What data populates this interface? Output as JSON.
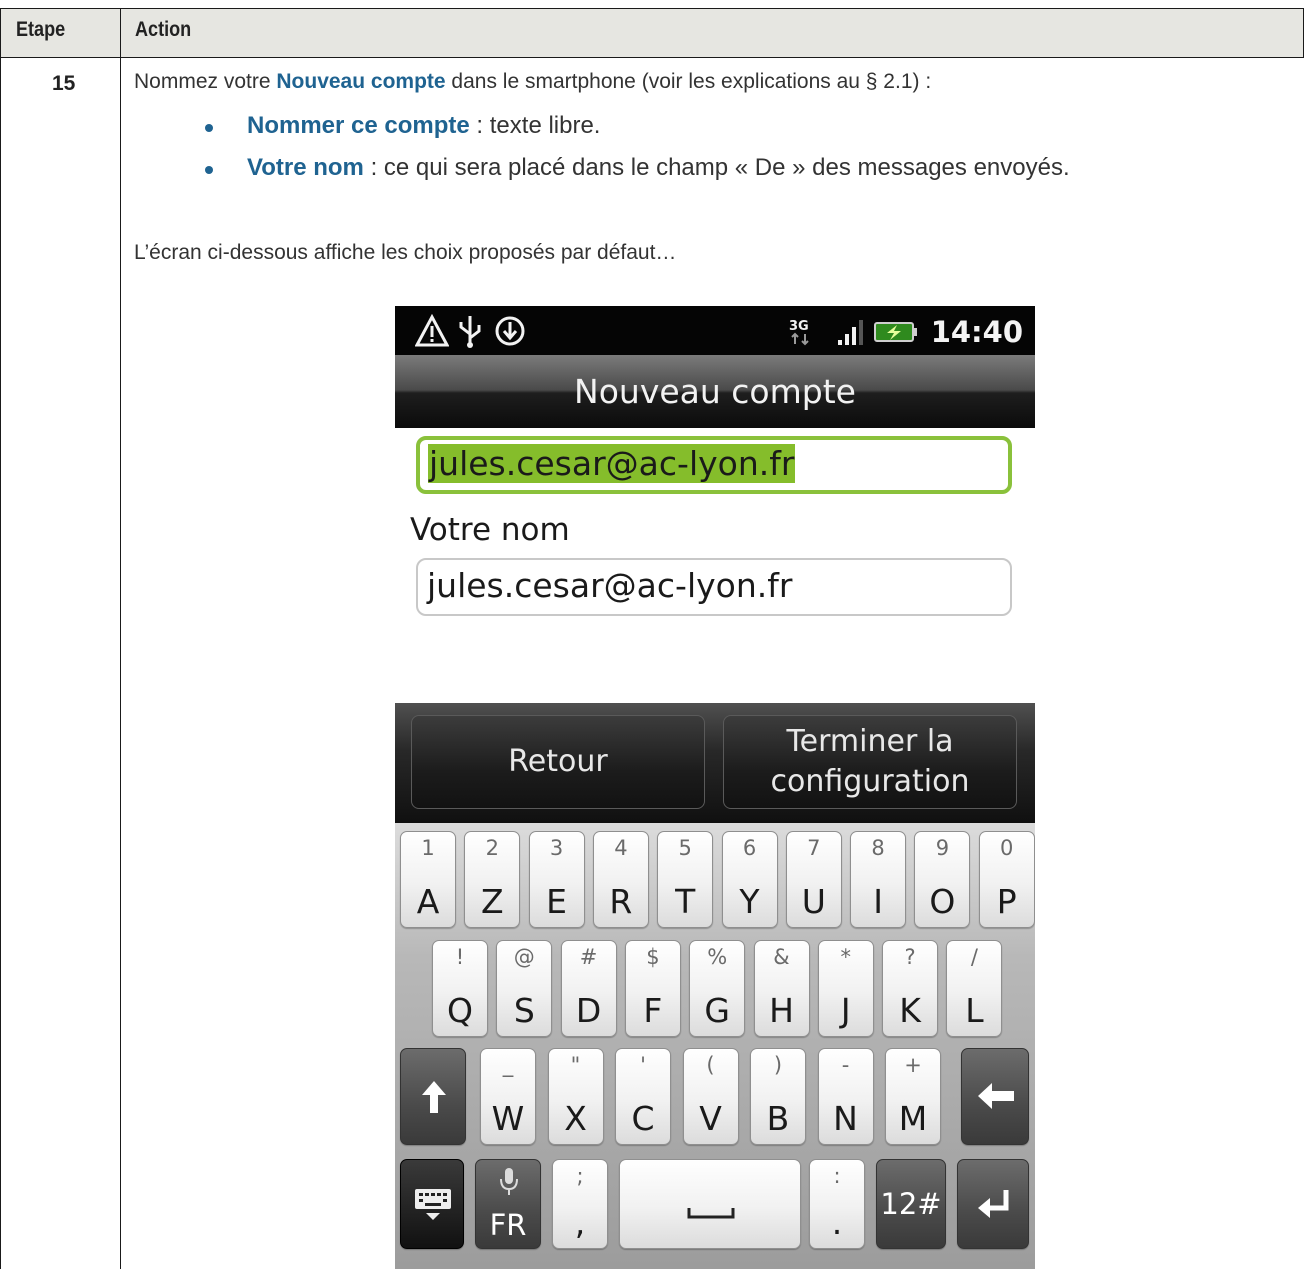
{
  "table": {
    "headers": [
      "Etape",
      "Action"
    ],
    "step_number": "15",
    "intro_before": "Nommez votre ",
    "intro_keyword": "Nouveau compte",
    "intro_after": " dans le smartphone (voir les explications au § 2.1) :",
    "bullets": [
      {
        "keyword": "Nommer ce compte",
        "text": " : texte libre."
      },
      {
        "keyword": "Votre nom",
        "text": " : ce qui sera placé dans le champ « De » des messages envoyés."
      }
    ],
    "note": "L’écran ci-dessous affiche les choix proposés par défaut…"
  },
  "phone": {
    "status_bar": {
      "left_icons": [
        "warning-icon",
        "usb-icon",
        "download-icon"
      ],
      "right_icons": [
        "3g-icon",
        "signal-icon",
        "battery-charging-icon"
      ],
      "time": "14:40"
    },
    "title": "Nouveau compte",
    "account_name_field": "jules.cesar@ac-lyon.fr",
    "your_name_label": "Votre nom",
    "your_name_field": "jules.cesar@ac-lyon.fr",
    "buttons": {
      "back": "Retour",
      "finish_line1": "Terminer la",
      "finish_line2": "configuration"
    },
    "keyboard": {
      "row1": [
        {
          "sub": "1",
          "main": "A"
        },
        {
          "sub": "2",
          "main": "Z"
        },
        {
          "sub": "3",
          "main": "E"
        },
        {
          "sub": "4",
          "main": "R"
        },
        {
          "sub": "5",
          "main": "T"
        },
        {
          "sub": "6",
          "main": "Y"
        },
        {
          "sub": "7",
          "main": "U"
        },
        {
          "sub": "8",
          "main": "I"
        },
        {
          "sub": "9",
          "main": "O"
        },
        {
          "sub": "0",
          "main": "P"
        }
      ],
      "row2": [
        {
          "sub": "!",
          "main": "Q"
        },
        {
          "sub": "@",
          "main": "S"
        },
        {
          "sub": "#",
          "main": "D"
        },
        {
          "sub": "$",
          "main": "F"
        },
        {
          "sub": "%",
          "main": "G"
        },
        {
          "sub": "&",
          "main": "H"
        },
        {
          "sub": "*",
          "main": "J"
        },
        {
          "sub": "?",
          "main": "K"
        },
        {
          "sub": "/",
          "main": "L"
        }
      ],
      "row3": [
        {
          "sub": "_",
          "main": "W"
        },
        {
          "sub": "\"",
          "main": "X"
        },
        {
          "sub": "'",
          "main": "C"
        },
        {
          "sub": "(",
          "main": "V"
        },
        {
          "sub": ")",
          "main": "B"
        },
        {
          "sub": "-",
          "main": "N"
        },
        {
          "sub": "+",
          "main": "M"
        }
      ],
      "lang_label": "FR",
      "semicolon": ";",
      "comma": ",",
      "colon": ":",
      "period": ".",
      "symbols_label": "12#"
    }
  }
}
